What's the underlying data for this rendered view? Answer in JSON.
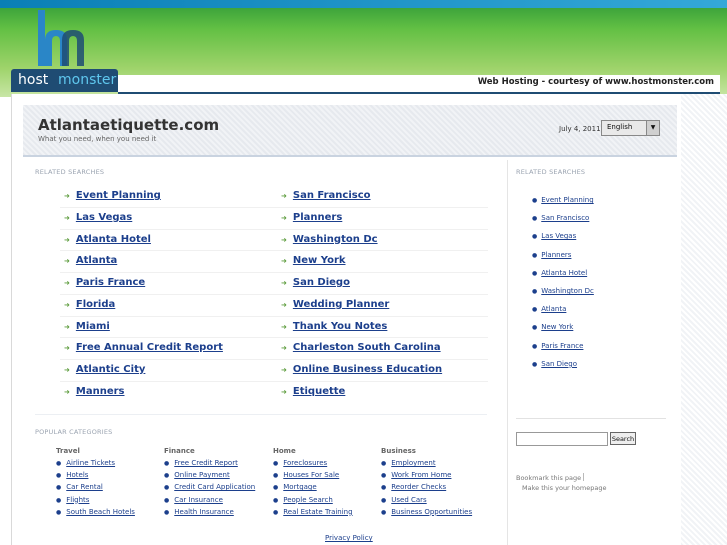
{
  "brand": {
    "logo_part1": "host",
    "logo_part2": "monster",
    "courtesy": "Web Hosting - courtesy of www.hostmonster.com",
    "colors": {
      "green": "#63c044",
      "navy": "#1f4c73",
      "cyan": "#5fc7ee",
      "link": "#1c3f8c"
    }
  },
  "header": {
    "title": "Atlantaetiquette.com",
    "tagline": "What you need, when you need it",
    "date": "July 4, 2011",
    "language": "English"
  },
  "main": {
    "label": "RELATED SEARCHES",
    "links_left": [
      "Event Planning",
      "Las Vegas",
      "Atlanta Hotel",
      "Atlanta",
      "Paris France",
      "Florida",
      "Miami",
      "Free Annual Credit Report",
      "Atlantic City",
      "Manners"
    ],
    "links_right": [
      "San Francisco",
      "Planners",
      "Washington Dc",
      "New York",
      "San Diego",
      "Wedding Planner",
      "Thank You Notes",
      "Charleston South Carolina",
      "Online Business Education",
      "Etiquette"
    ]
  },
  "sidebar": {
    "label": "RELATED SEARCHES",
    "links": [
      "Event Planning",
      "San Francisco",
      "Las Vegas",
      "Planners",
      "Atlanta Hotel",
      "Washington Dc",
      "Atlanta",
      "New York",
      "Paris France",
      "San Diego"
    ],
    "search_button": "Search",
    "bookmark": "Bookmark this page",
    "homepage": "Make this your homepage"
  },
  "popular": {
    "label": "POPULAR CATEGORIES",
    "categories": [
      {
        "title": "Travel",
        "links": [
          "Airline Tickets",
          "Hotels",
          "Car Rental",
          "Flights",
          "South Beach Hotels"
        ]
      },
      {
        "title": "Finance",
        "links": [
          "Free Credit Report",
          "Online Payment",
          "Credit Card Application",
          "Car Insurance",
          "Health Insurance"
        ]
      },
      {
        "title": "Home",
        "links": [
          "Foreclosures",
          "Houses For Sale",
          "Mortgage",
          "People Search",
          "Real Estate Training"
        ]
      },
      {
        "title": "Business",
        "links": [
          "Employment",
          "Work From Home",
          "Reorder Checks",
          "Used Cars",
          "Business Opportunities"
        ]
      }
    ]
  },
  "footer": {
    "privacy": "Privacy Policy"
  }
}
